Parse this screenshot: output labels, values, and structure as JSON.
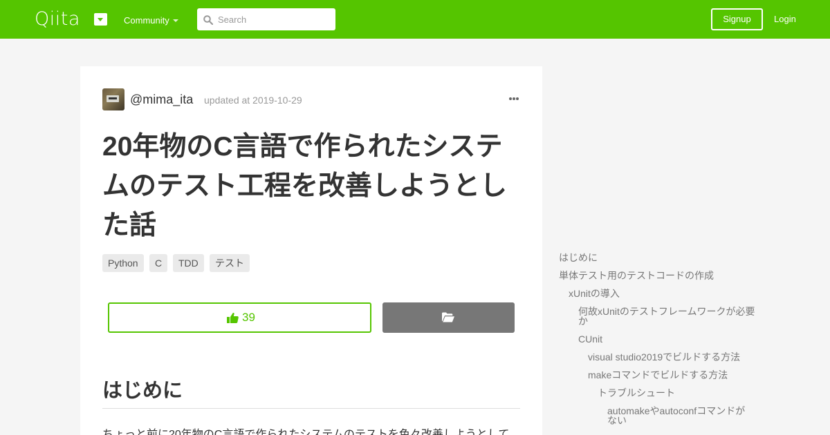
{
  "header": {
    "logo": "Qiita",
    "community_label": "Community",
    "search_placeholder": "Search",
    "signup_label": "Signup",
    "login_label": "Login",
    "brand_color": "#55c500"
  },
  "article": {
    "author": "@mima_ita",
    "updated": "updated at 2019-10-29",
    "title": "20年物のC言語で作られたシステムのテスト工程を改善しようとした話",
    "tags": [
      "Python",
      "C",
      "TDD",
      "テスト"
    ],
    "like_count": "39",
    "section_heading": "はじめに",
    "body_text": "ちょっと前に20年物のC言語で作られたシステムのテストを色々改善しようとして"
  },
  "toc": {
    "items": [
      "はじめに",
      "単体テスト用のテストコードの作成",
      "xUnitの導入",
      "何故xUnitのテストフレームワークが必要か",
      "CUnit",
      "visual studio2019でビルドする方法",
      "makeコマンドでビルドする方法",
      "トラブルシュート",
      "automakeやautoconfコマンドがない"
    ]
  },
  "icons": {
    "search": "search-icon",
    "like": "thumbs-up-icon",
    "stock": "folder-open-icon",
    "more": "more-icon"
  }
}
